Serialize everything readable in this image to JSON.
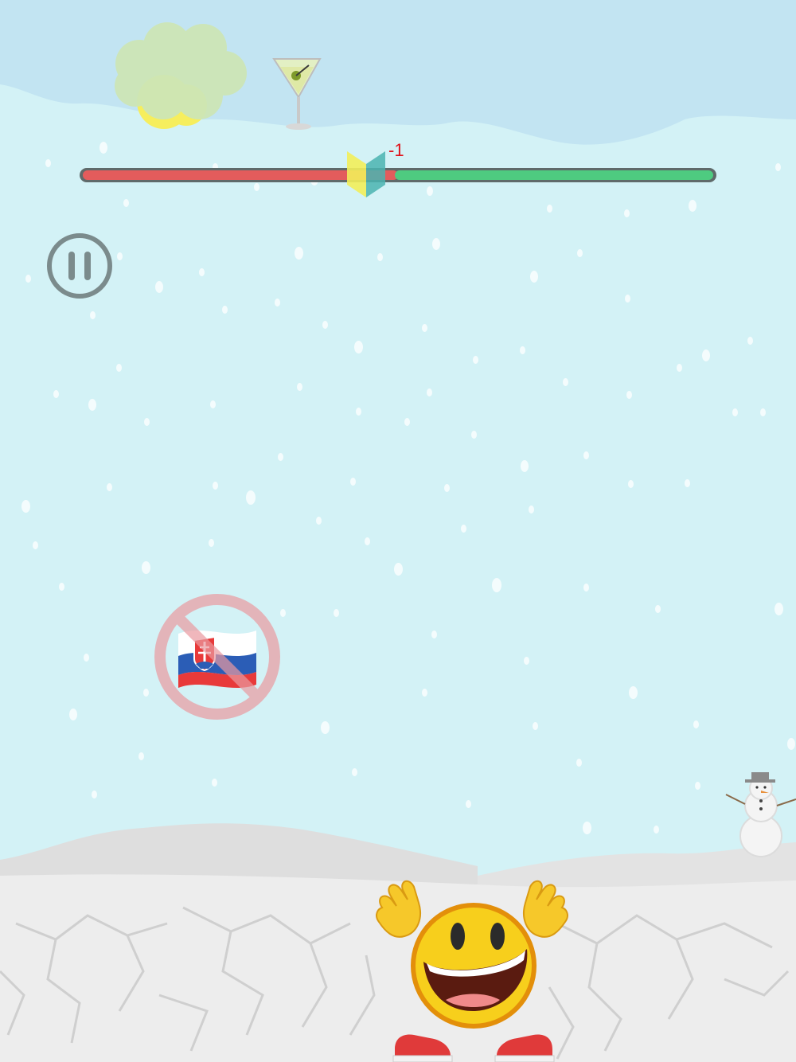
{
  "hud": {
    "balance_change_text": "-1",
    "balance_level": 0.45,
    "pause_label": "pause"
  },
  "items": [
    {
      "name": "martini-glass",
      "icon": "cocktail-glass-icon"
    },
    {
      "name": "forbidden-slovakia-flag",
      "icon": "slovakia-flag-icon",
      "overlay": "prohibited-icon"
    }
  ],
  "scene": {
    "theme": "winter",
    "decor": [
      "cloud-icon",
      "sun-icon",
      "snowman-icon"
    ]
  },
  "player": {
    "character": "grinning-emoji",
    "icon": "smiling-face-icon"
  },
  "colors": {
    "sky": "#d3f2f6",
    "negative_bar": "#e35c5c",
    "positive_bar": "#4ecb80",
    "marker_left": "#f2ee5a",
    "marker_right": "#4ab4b0",
    "ground": "#ebebeb",
    "score_text": "#e0121a"
  }
}
